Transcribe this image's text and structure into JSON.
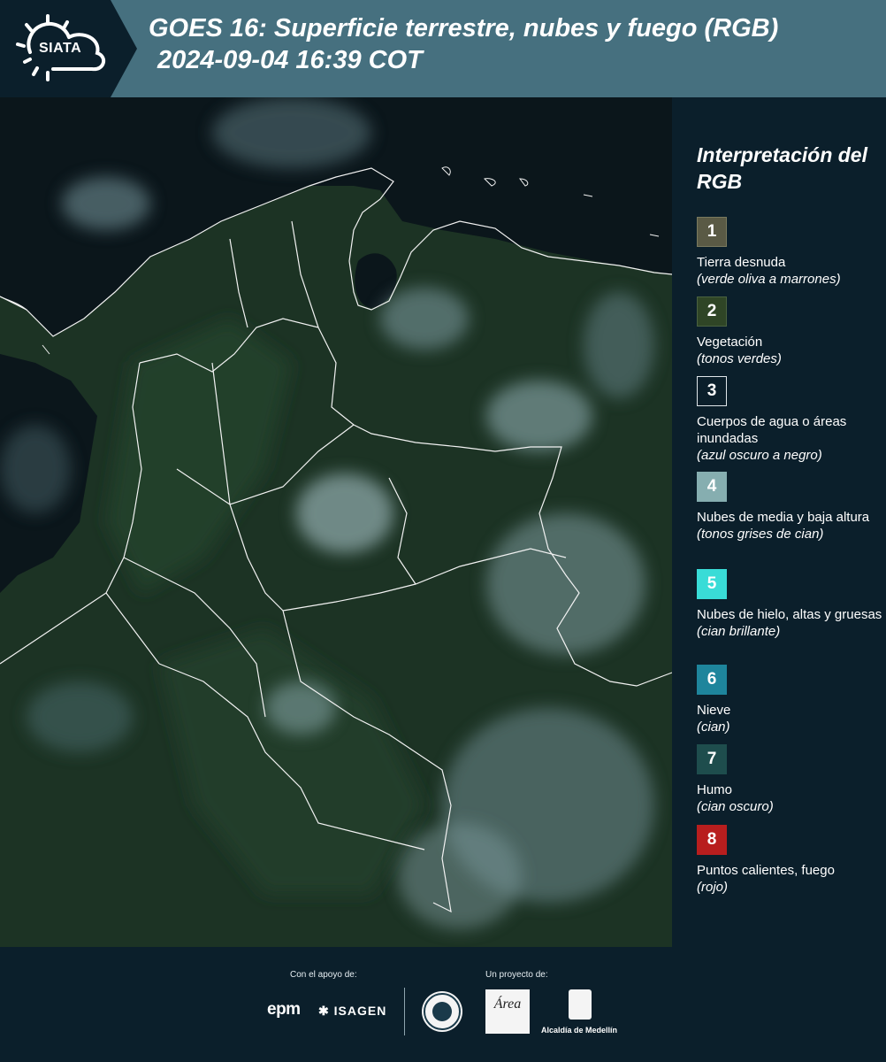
{
  "header": {
    "logo_text": "SIATA",
    "title_line1": "GOES 16: Superficie terrestre, nubes y fuego (RGB)",
    "title_line2": "2024-09-04 16:39 COT"
  },
  "legend": {
    "title": "Interpretación del RGB",
    "items": [
      {
        "num": "1",
        "color": "#5a5a45",
        "label": "Tierra desnuda",
        "sub": "(verde oliva a marrones)"
      },
      {
        "num": "2",
        "color": "#2f4526",
        "label": "Vegetación",
        "sub": "(tonos verdes)"
      },
      {
        "num": "3",
        "color": "#0b1f2b",
        "label": "Cuerpos de agua o áreas inundadas",
        "sub": "(azul oscuro a negro)"
      },
      {
        "num": "4",
        "color": "#86aeb0",
        "label": "Nubes de media y baja altura",
        "sub": "(tonos grises de cian)"
      },
      {
        "num": "5",
        "color": "#39dcd7",
        "label": "Nubes de hielo, altas y gruesas",
        "sub": "(cian brillante)"
      },
      {
        "num": "6",
        "color": "#1e859c",
        "label": "Nieve",
        "sub": "(cian)"
      },
      {
        "num": "7",
        "color": "#1e4d4d",
        "label": "Humo",
        "sub": "(cian oscuro)"
      },
      {
        "num": "8",
        "color": "#b81e1e",
        "label": "Puntos calientes, fuego",
        "sub": "(rojo)"
      }
    ]
  },
  "footer": {
    "support_label": "Con el apoyo de:",
    "project_label": "Un proyecto de:",
    "epm": "epm",
    "isagen": "ISAGEN",
    "area_logo": "Área",
    "alcaldia": "Alcaldía de Medellín"
  }
}
